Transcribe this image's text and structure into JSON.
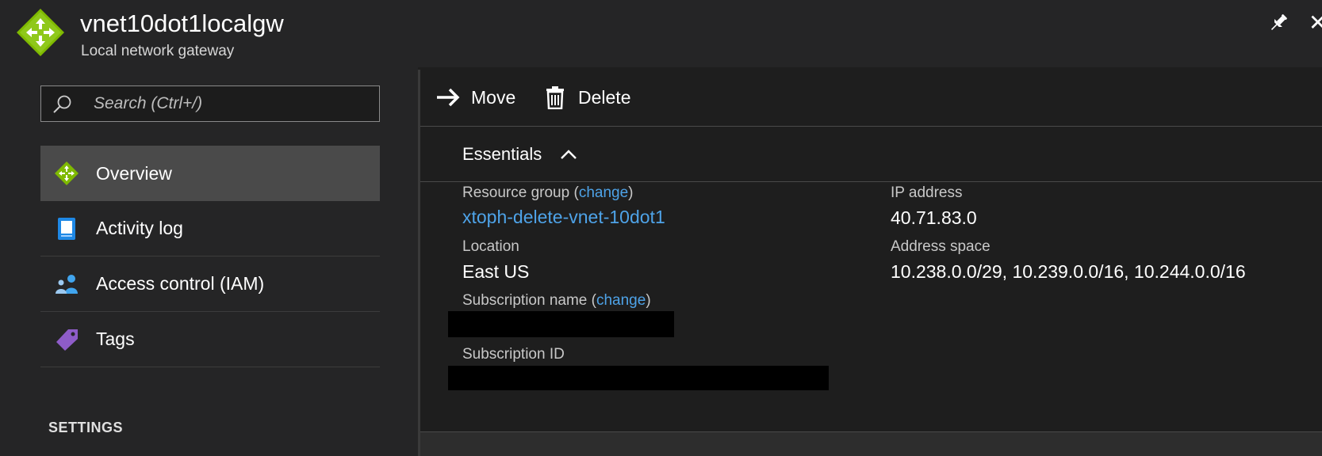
{
  "header": {
    "title": "vnet10dot1localgw",
    "subtitle": "Local network gateway",
    "close_glyph": "✕",
    "icons": {
      "logo": "gateway-arrows-icon",
      "pin": "pin-icon",
      "close": "close-icon"
    }
  },
  "sidebar": {
    "search_placeholder": "Search (Ctrl+/)",
    "items": [
      {
        "label": "Overview",
        "icon": "gateway-overview-icon",
        "active": true
      },
      {
        "label": "Activity log",
        "icon": "activity-log-icon",
        "active": false
      },
      {
        "label": "Access control (IAM)",
        "icon": "access-control-icon",
        "active": false
      },
      {
        "label": "Tags",
        "icon": "tag-icon",
        "active": false
      }
    ],
    "settings_heading": "SETTINGS"
  },
  "toolbar": {
    "move_label": "Move",
    "delete_label": "Delete"
  },
  "essentials": {
    "heading": "Essentials",
    "resource_group": {
      "label": "Resource group",
      "change_open": "(",
      "change_link": "change",
      "change_close": ")",
      "value": "xtoph-delete-vnet-10dot1"
    },
    "location": {
      "label": "Location",
      "value": "East US"
    },
    "subscription_name": {
      "label": "Subscription name",
      "change_open": "(",
      "change_link": "change",
      "change_close": ")",
      "value_redacted": true
    },
    "subscription_id": {
      "label": "Subscription ID",
      "value_redacted": true
    },
    "ip_address": {
      "label": "IP address",
      "value": "40.71.83.0"
    },
    "address_space": {
      "label": "Address space",
      "value": "10.238.0.0/29, 10.239.0.0/16, 10.244.0.0/16"
    }
  },
  "colors": {
    "accent_link": "#4ea3e8",
    "logo_green": "#7fba00",
    "activity_blue": "#1e88e5",
    "tag_purple": "#8e5cc8"
  }
}
